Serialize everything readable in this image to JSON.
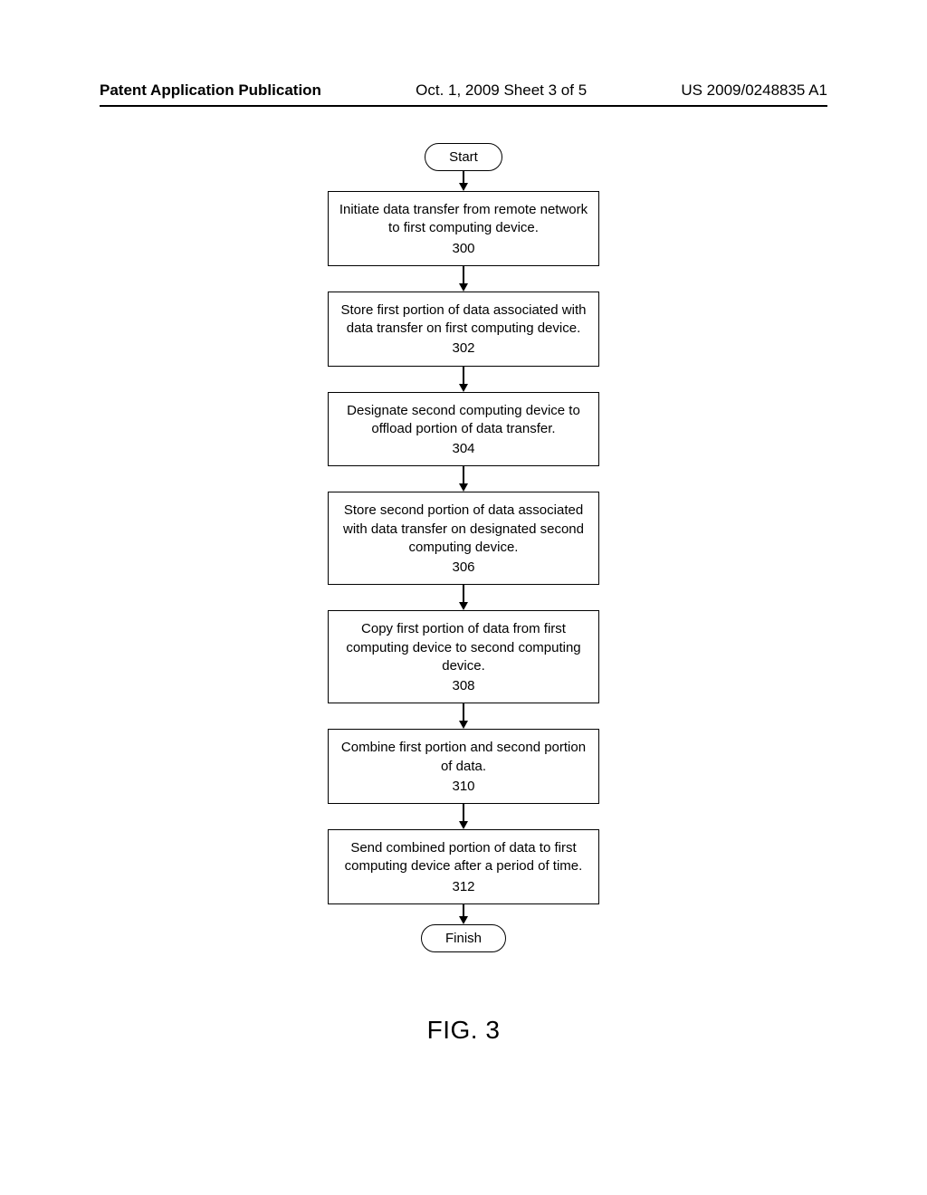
{
  "header": {
    "left": "Patent Application Publication",
    "center": "Oct. 1, 2009   Sheet 3 of 5",
    "right": "US 2009/0248835 A1"
  },
  "flow": {
    "start": "Start",
    "finish": "Finish",
    "steps": [
      {
        "text": "Initiate data transfer from remote network to first computing device.",
        "num": "300"
      },
      {
        "text": "Store first portion of data associated with data transfer on first computing device.",
        "num": "302"
      },
      {
        "text": "Designate second computing device to offload portion of data transfer.",
        "num": "304"
      },
      {
        "text": "Store second portion of data associated with data transfer on designated second computing device.",
        "num": "306"
      },
      {
        "text": "Copy first portion of data from first computing device to second computing device.",
        "num": "308"
      },
      {
        "text": "Combine first portion and second portion of data.",
        "num": "310"
      },
      {
        "text": "Send combined portion of data to first computing device after a period of time.",
        "num": "312"
      }
    ]
  },
  "figure_label": "FIG. 3"
}
